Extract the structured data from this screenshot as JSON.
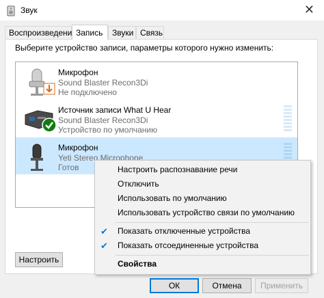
{
  "window": {
    "title": "Звук",
    "close_glyph": "✕"
  },
  "tabs": [
    {
      "label": "Воспроизведение",
      "active": false
    },
    {
      "label": "Запись",
      "active": true
    },
    {
      "label": "Звуки",
      "active": false
    },
    {
      "label": "Связь",
      "active": false
    }
  ],
  "panel": {
    "instruction": "Выберите устройство записи, параметры которого нужно изменить:"
  },
  "devices": [
    {
      "name": "Микрофон",
      "sub": "Sound Blaster Recon3Di",
      "status": "Не подключено",
      "icon": "microphone-icon",
      "badge": "disconnected-arrow-icon"
    },
    {
      "name": "Источник записи What U Hear",
      "sub": "Sound Blaster Recon3Di",
      "status": "Устройство по умолчанию",
      "icon": "sound-card-icon",
      "badge": "default-checkmark-icon"
    },
    {
      "name": "Микрофон",
      "sub": "Yeti Stereo Microphone",
      "status": "Готов",
      "icon": "microphone-icon",
      "selected": true
    }
  ],
  "configure_label": "Настроить",
  "buttons": {
    "ok": "ОК",
    "cancel": "Отмена",
    "apply": "Применить"
  },
  "context_menu": {
    "items": [
      {
        "label": "Настроить распознавание речи"
      },
      {
        "label": "Отключить"
      },
      {
        "label": "Использовать по умолчанию"
      },
      {
        "label": "Использовать устройство связи по умолчанию"
      },
      {
        "label": "Показать отключенные устройства",
        "checked": true
      },
      {
        "label": "Показать отсоединенные устройства",
        "checked": true
      },
      {
        "label": "Свойства",
        "bold": true
      }
    ],
    "check_glyph": "✔"
  },
  "colors": {
    "accent": "#0078d7",
    "selection": "#cce8ff",
    "ok_green": "#107c10",
    "warn_orange": "#d86b1c"
  }
}
